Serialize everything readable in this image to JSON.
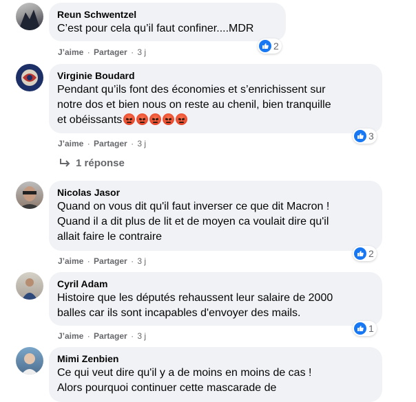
{
  "comments": [
    {
      "author": "Reun Schwentzel",
      "lines": [
        "C’est pour cela qu’il faut confiner....MDR"
      ],
      "like": "J’aime",
      "share": "Partager",
      "time": "3 j",
      "reaction_count": "2"
    },
    {
      "author": "Virginie Boudard",
      "lines": [
        "Pendant qu’ils font des économies et s’enrichissent sur",
        "notre dos et bien nous on reste au chenil, bien tranquille",
        "et obéissants"
      ],
      "emoji": "angry-face-icon",
      "emoji_count": 5,
      "like": "J’aime",
      "share": "Partager",
      "time": "3 j",
      "reaction_count": "3",
      "replies_label": "1 réponse"
    },
    {
      "author": "Nicolas Jasor",
      "lines": [
        "Quand on vous dit qu'il faut inverser ce que dit Macron !",
        "Quand il a dit plus de lit et de moyen ca voulait dire qu'il",
        "allait faire le contraire"
      ],
      "like": "J’aime",
      "share": "Partager",
      "time": "3 j",
      "reaction_count": "2"
    },
    {
      "author": "Cyril Adam",
      "lines": [
        "Histoire que les députés rehaussent leur salaire de 2000",
        "balles car ils sont incapables d'envoyer des mails."
      ],
      "like": "J’aime",
      "share": "Partager",
      "time": "3 j",
      "reaction_count": "1"
    },
    {
      "author": "Mimi Zenbien",
      "lines": [
        "Ce qui veut dire qu'il y a de moins en moins de cas !",
        "Alors pourquoi continuer cette mascarade de"
      ]
    }
  ],
  "colors": {
    "bubble": "#f0f2f5",
    "like_blue": "#1877f2",
    "meta_gray": "#65676b"
  }
}
